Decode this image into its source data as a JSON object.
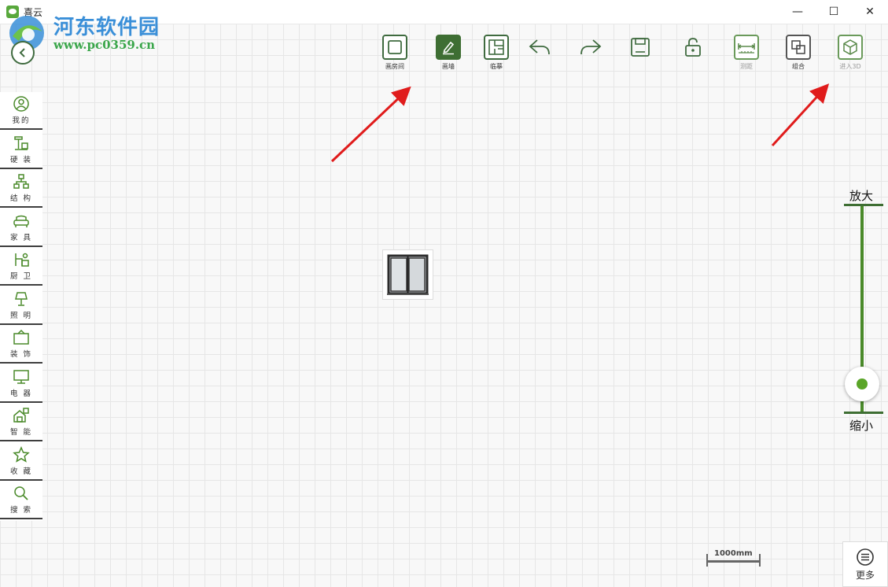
{
  "window": {
    "title": "喜云",
    "minimize_glyph": "—",
    "maximize_glyph": "☐",
    "close_glyph": "✕"
  },
  "watermark": {
    "line1": "河东软件园",
    "line2": "www.pc0359.cn"
  },
  "sidebar": {
    "items": [
      {
        "label": "我的",
        "icon": "user-icon"
      },
      {
        "label": "硬 装",
        "icon": "hardware-icon"
      },
      {
        "label": "结 构",
        "icon": "structure-icon"
      },
      {
        "label": "家 具",
        "icon": "sofa-icon"
      },
      {
        "label": "厨 卫",
        "icon": "kitchen-icon"
      },
      {
        "label": "照 明",
        "icon": "lamp-icon"
      },
      {
        "label": "装 饰",
        "icon": "frame-icon"
      },
      {
        "label": "电 器",
        "icon": "monitor-icon"
      },
      {
        "label": "智 能",
        "icon": "smart-home-icon"
      },
      {
        "label": "收 藏",
        "icon": "star-icon"
      },
      {
        "label": "搜 索",
        "icon": "search-icon"
      }
    ]
  },
  "toolbar": {
    "draw_room": "画房间",
    "draw_wall": "画墙",
    "trace": "临摹",
    "measure": "测距",
    "combine": "组合",
    "enter_3d": "进入3D"
  },
  "zoom": {
    "in_label": "放大",
    "out_label": "缩小",
    "level": 0.08
  },
  "scale": {
    "label": "1000mm"
  },
  "more": {
    "label": "更多"
  },
  "colors": {
    "accent": "#3e6e33",
    "slider_green": "#5aa528",
    "annotation_arrow": "#e01b1b"
  }
}
